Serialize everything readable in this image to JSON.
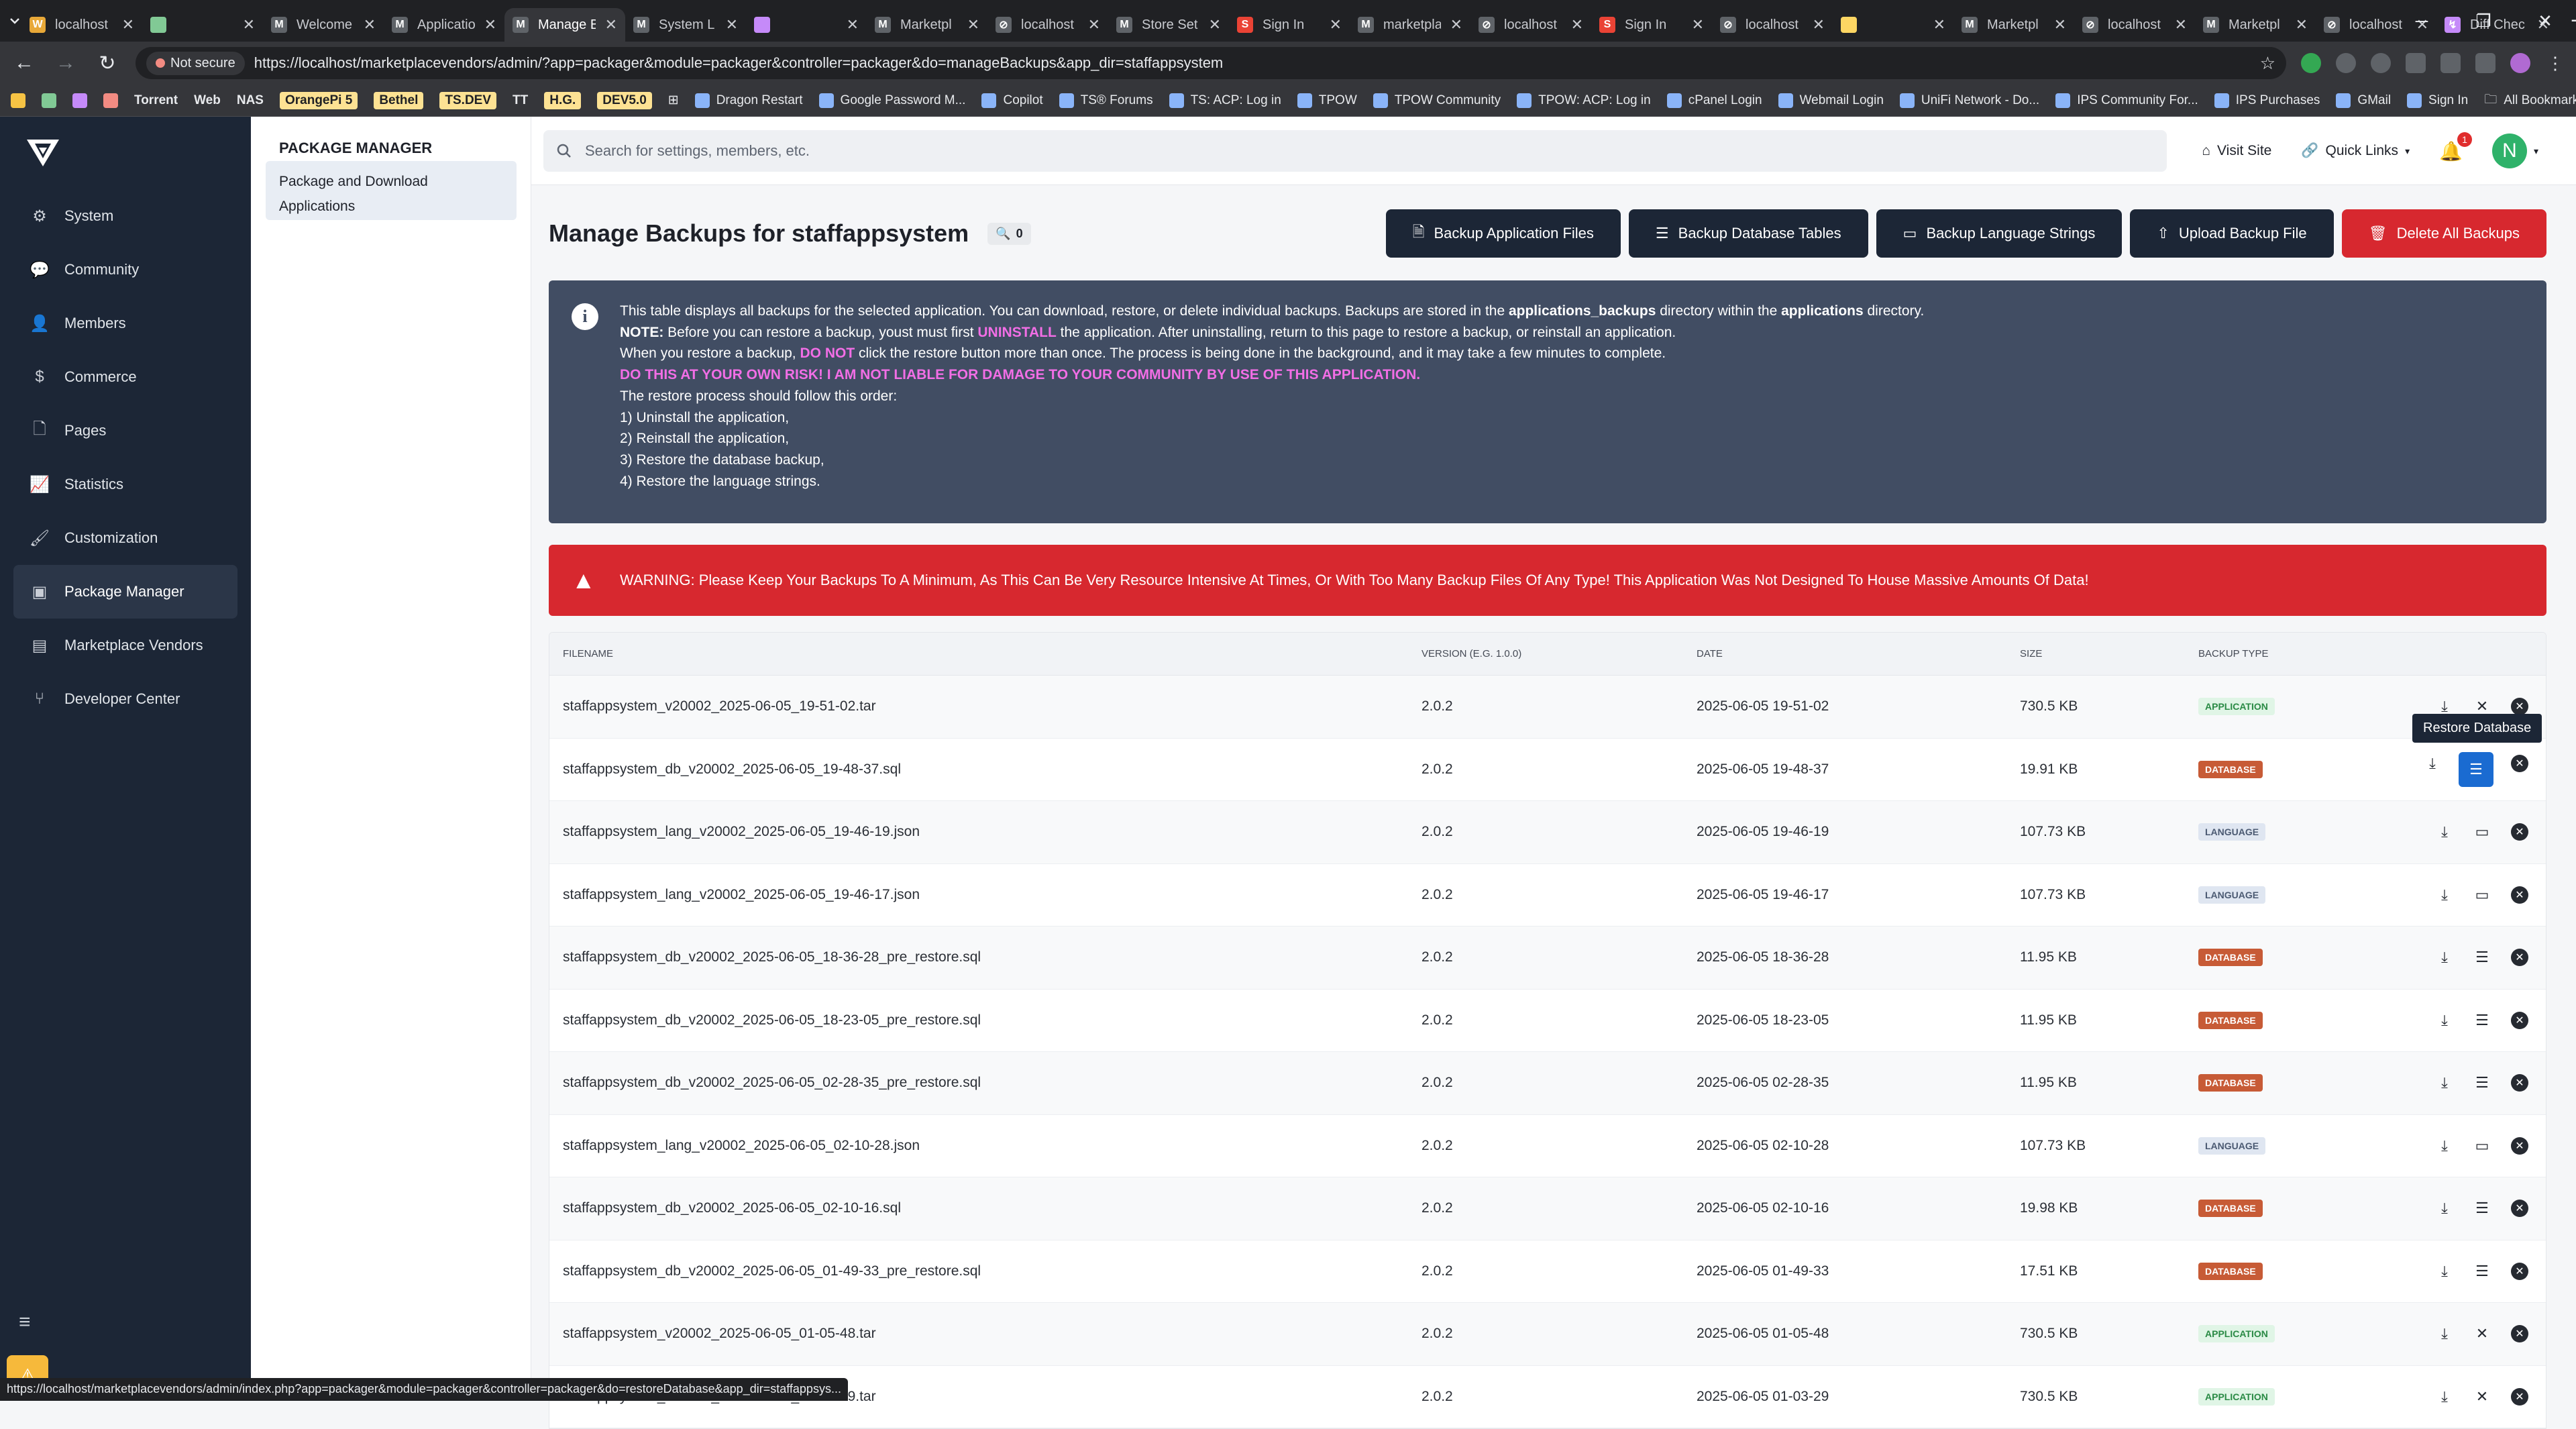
{
  "browser": {
    "tabs": [
      {
        "title": "localhost",
        "fav": "#e8a838",
        "glyph": "W"
      },
      {
        "title": "",
        "fav": "#81c995",
        "glyph": ""
      },
      {
        "title": "Welcome",
        "fav": "#5f6368",
        "glyph": "M"
      },
      {
        "title": "Applicatio",
        "fav": "#5f6368",
        "glyph": "M"
      },
      {
        "title": "Manage B",
        "fav": "#5f6368",
        "glyph": "M",
        "active": true
      },
      {
        "title": "System L",
        "fav": "#5f6368",
        "glyph": "M"
      },
      {
        "title": "",
        "fav": "#c58af9",
        "glyph": ""
      },
      {
        "title": "Marketpl",
        "fav": "#5f6368",
        "glyph": "M"
      },
      {
        "title": "localhost",
        "fav": "#5f6368",
        "glyph": "⊘"
      },
      {
        "title": "Store Set",
        "fav": "#5f6368",
        "glyph": "M"
      },
      {
        "title": "Sign In",
        "fav": "#ea4335",
        "glyph": "S"
      },
      {
        "title": "marketpla",
        "fav": "#5f6368",
        "glyph": "M"
      },
      {
        "title": "localhost",
        "fav": "#5f6368",
        "glyph": "⊘"
      },
      {
        "title": "Sign In",
        "fav": "#ea4335",
        "glyph": "S"
      },
      {
        "title": "localhost",
        "fav": "#5f6368",
        "glyph": "⊘"
      },
      {
        "title": "",
        "fav": "#fdd663",
        "glyph": ""
      },
      {
        "title": "Marketpl",
        "fav": "#5f6368",
        "glyph": "M"
      },
      {
        "title": "localhost",
        "fav": "#5f6368",
        "glyph": "⊘"
      },
      {
        "title": "Marketpl",
        "fav": "#5f6368",
        "glyph": "M"
      },
      {
        "title": "localhost",
        "fav": "#5f6368",
        "glyph": "⊘"
      },
      {
        "title": "Diff Chec",
        "fav": "#c58af9",
        "glyph": "↯"
      }
    ],
    "not_secure": "Not secure",
    "url": "https://localhost/marketplacevendors/admin/?app=packager&module=packager&controller=packager&do=manageBackups&app_dir=staffappsystem",
    "bookmarks": [
      "Torrent",
      "Web",
      "NAS",
      "OrangePi 5",
      "Bethel",
      "TS.DEV",
      "TT",
      "H.G.",
      "DEV5.0",
      "Dragon Restart",
      "Google Password M...",
      "Copilot",
      "TS® Forums",
      "TS: ACP: Log in",
      "TPOW",
      "TPOW Community",
      "TPOW: ACP: Log in",
      "cPanel Login",
      "Webmail Login",
      "UniFi Network - Do...",
      "IPS Community For...",
      "IPS Purchases",
      "GMail",
      "Sign In"
    ],
    "all_bookmarks": "All Bookmarks",
    "status_url": "https://localhost/marketplacevendors/admin/index.php?app=packager&module=packager&controller=packager&do=restoreDatabase&app_dir=staffappsys..."
  },
  "sidebar": {
    "items": [
      {
        "label": "System",
        "icon": "gears-icon",
        "glyph": "⚙"
      },
      {
        "label": "Community",
        "icon": "comments-icon",
        "glyph": "💬"
      },
      {
        "label": "Members",
        "icon": "user-icon",
        "glyph": "👤"
      },
      {
        "label": "Commerce",
        "icon": "dollar-icon",
        "glyph": "$"
      },
      {
        "label": "Pages",
        "icon": "file-icon",
        "glyph": "🗋"
      },
      {
        "label": "Statistics",
        "icon": "chart-line-icon",
        "glyph": "📈"
      },
      {
        "label": "Customization",
        "icon": "brush-icon",
        "glyph": "🖌"
      },
      {
        "label": "Package Manager",
        "icon": "box-icon",
        "glyph": "▣",
        "active": true
      },
      {
        "label": "Marketplace Vendors",
        "icon": "store-icon",
        "glyph": "▤"
      },
      {
        "label": "Developer Center",
        "icon": "code-branch-icon",
        "glyph": "⑂"
      }
    ]
  },
  "subnav": {
    "title": "PACKAGE MANAGER",
    "item": "Package and Download Applications"
  },
  "topbar": {
    "search_placeholder": "Search for settings, members, etc.",
    "visit_site": "Visit Site",
    "quick_links": "Quick Links",
    "notif_count": "1",
    "avatar_letter": "N"
  },
  "page": {
    "title": "Manage Backups for staffappsystem",
    "count": "0",
    "buttons": {
      "app": "Backup Application Files",
      "db": "Backup Database Tables",
      "lang": "Backup Language Strings",
      "upload": "Upload Backup File",
      "delete": "Delete All Backups"
    },
    "info": {
      "l1a": "This table displays all backups for the selected application. You can download, restore, or delete individual backups. Backups are stored in the ",
      "l1b": "applications_backups",
      "l1c": " directory within the ",
      "l1d": "applications",
      "l1e": " directory.",
      "l2a": "NOTE:",
      "l2b": " Before you can restore a backup, youst must first ",
      "l2c": "UNINSTALL",
      "l2d": " the application. After uninstalling, return to this page to restore a backup, or reinstall an application.",
      "l3a": "When you restore a backup, ",
      "l3b": "DO NOT",
      "l3c": " click the restore button more than once. The process is being done in the background, and it may take a few minutes to complete.",
      "l4": "DO THIS AT YOUR OWN RISK! I AM NOT LIABLE FOR DAMAGE TO YOUR COMMUNITY BY USE OF THIS APPLICATION.",
      "l5": "The restore process should follow this order:",
      "l6": "1) Uninstall the application,",
      "l7": "2) Reinstall the application,",
      "l8": "3) Restore the database backup,",
      "l9": "4) Restore the language strings."
    },
    "warning": "WARNING: Please Keep Your Backups To A Minimum, As This Can Be Very Resource Intensive At Times, Or With Too Many Backup Files Of Any Type! This Application Was Not Designed To House Massive Amounts Of Data!",
    "tooltip": "Restore Database"
  },
  "table": {
    "headers": [
      "FILENAME",
      "VERSION (E.G. 1.0.0)",
      "DATE",
      "SIZE",
      "BACKUP TYPE"
    ],
    "rows": [
      {
        "file": "staffappsystem_v20002_2025-06-05_19-51-02.tar",
        "ver": "2.0.2",
        "date": "2025-06-05 19-51-02",
        "size": "730.5 KB",
        "type": "APPLICATION",
        "kind": "app"
      },
      {
        "file": "staffappsystem_db_v20002_2025-06-05_19-48-37.sql",
        "ver": "2.0.2",
        "date": "2025-06-05 19-48-37",
        "size": "19.91 KB",
        "type": "DATABASE",
        "kind": "db",
        "hl": true
      },
      {
        "file": "staffappsystem_lang_v20002_2025-06-05_19-46-19.json",
        "ver": "2.0.2",
        "date": "2025-06-05 19-46-19",
        "size": "107.73 KB",
        "type": "LANGUAGE",
        "kind": "lang"
      },
      {
        "file": "staffappsystem_lang_v20002_2025-06-05_19-46-17.json",
        "ver": "2.0.2",
        "date": "2025-06-05 19-46-17",
        "size": "107.73 KB",
        "type": "LANGUAGE",
        "kind": "lang"
      },
      {
        "file": "staffappsystem_db_v20002_2025-06-05_18-36-28_pre_restore.sql",
        "ver": "2.0.2",
        "date": "2025-06-05 18-36-28",
        "size": "11.95 KB",
        "type": "DATABASE",
        "kind": "db"
      },
      {
        "file": "staffappsystem_db_v20002_2025-06-05_18-23-05_pre_restore.sql",
        "ver": "2.0.2",
        "date": "2025-06-05 18-23-05",
        "size": "11.95 KB",
        "type": "DATABASE",
        "kind": "db"
      },
      {
        "file": "staffappsystem_db_v20002_2025-06-05_02-28-35_pre_restore.sql",
        "ver": "2.0.2",
        "date": "2025-06-05 02-28-35",
        "size": "11.95 KB",
        "type": "DATABASE",
        "kind": "db"
      },
      {
        "file": "staffappsystem_lang_v20002_2025-06-05_02-10-28.json",
        "ver": "2.0.2",
        "date": "2025-06-05 02-10-28",
        "size": "107.73 KB",
        "type": "LANGUAGE",
        "kind": "lang"
      },
      {
        "file": "staffappsystem_db_v20002_2025-06-05_02-10-16.sql",
        "ver": "2.0.2",
        "date": "2025-06-05 02-10-16",
        "size": "19.98 KB",
        "type": "DATABASE",
        "kind": "db"
      },
      {
        "file": "staffappsystem_db_v20002_2025-06-05_01-49-33_pre_restore.sql",
        "ver": "2.0.2",
        "date": "2025-06-05 01-49-33",
        "size": "17.51 KB",
        "type": "DATABASE",
        "kind": "db"
      },
      {
        "file": "staffappsystem_v20002_2025-06-05_01-05-48.tar",
        "ver": "2.0.2",
        "date": "2025-06-05 01-05-48",
        "size": "730.5 KB",
        "type": "APPLICATION",
        "kind": "app"
      },
      {
        "file": "staffappsystem_v20002_2025-06-05_01-03-29.tar",
        "ver": "2.0.2",
        "date": "2025-06-05 01-03-29",
        "size": "730.5 KB",
        "type": "APPLICATION",
        "kind": "app"
      }
    ]
  }
}
